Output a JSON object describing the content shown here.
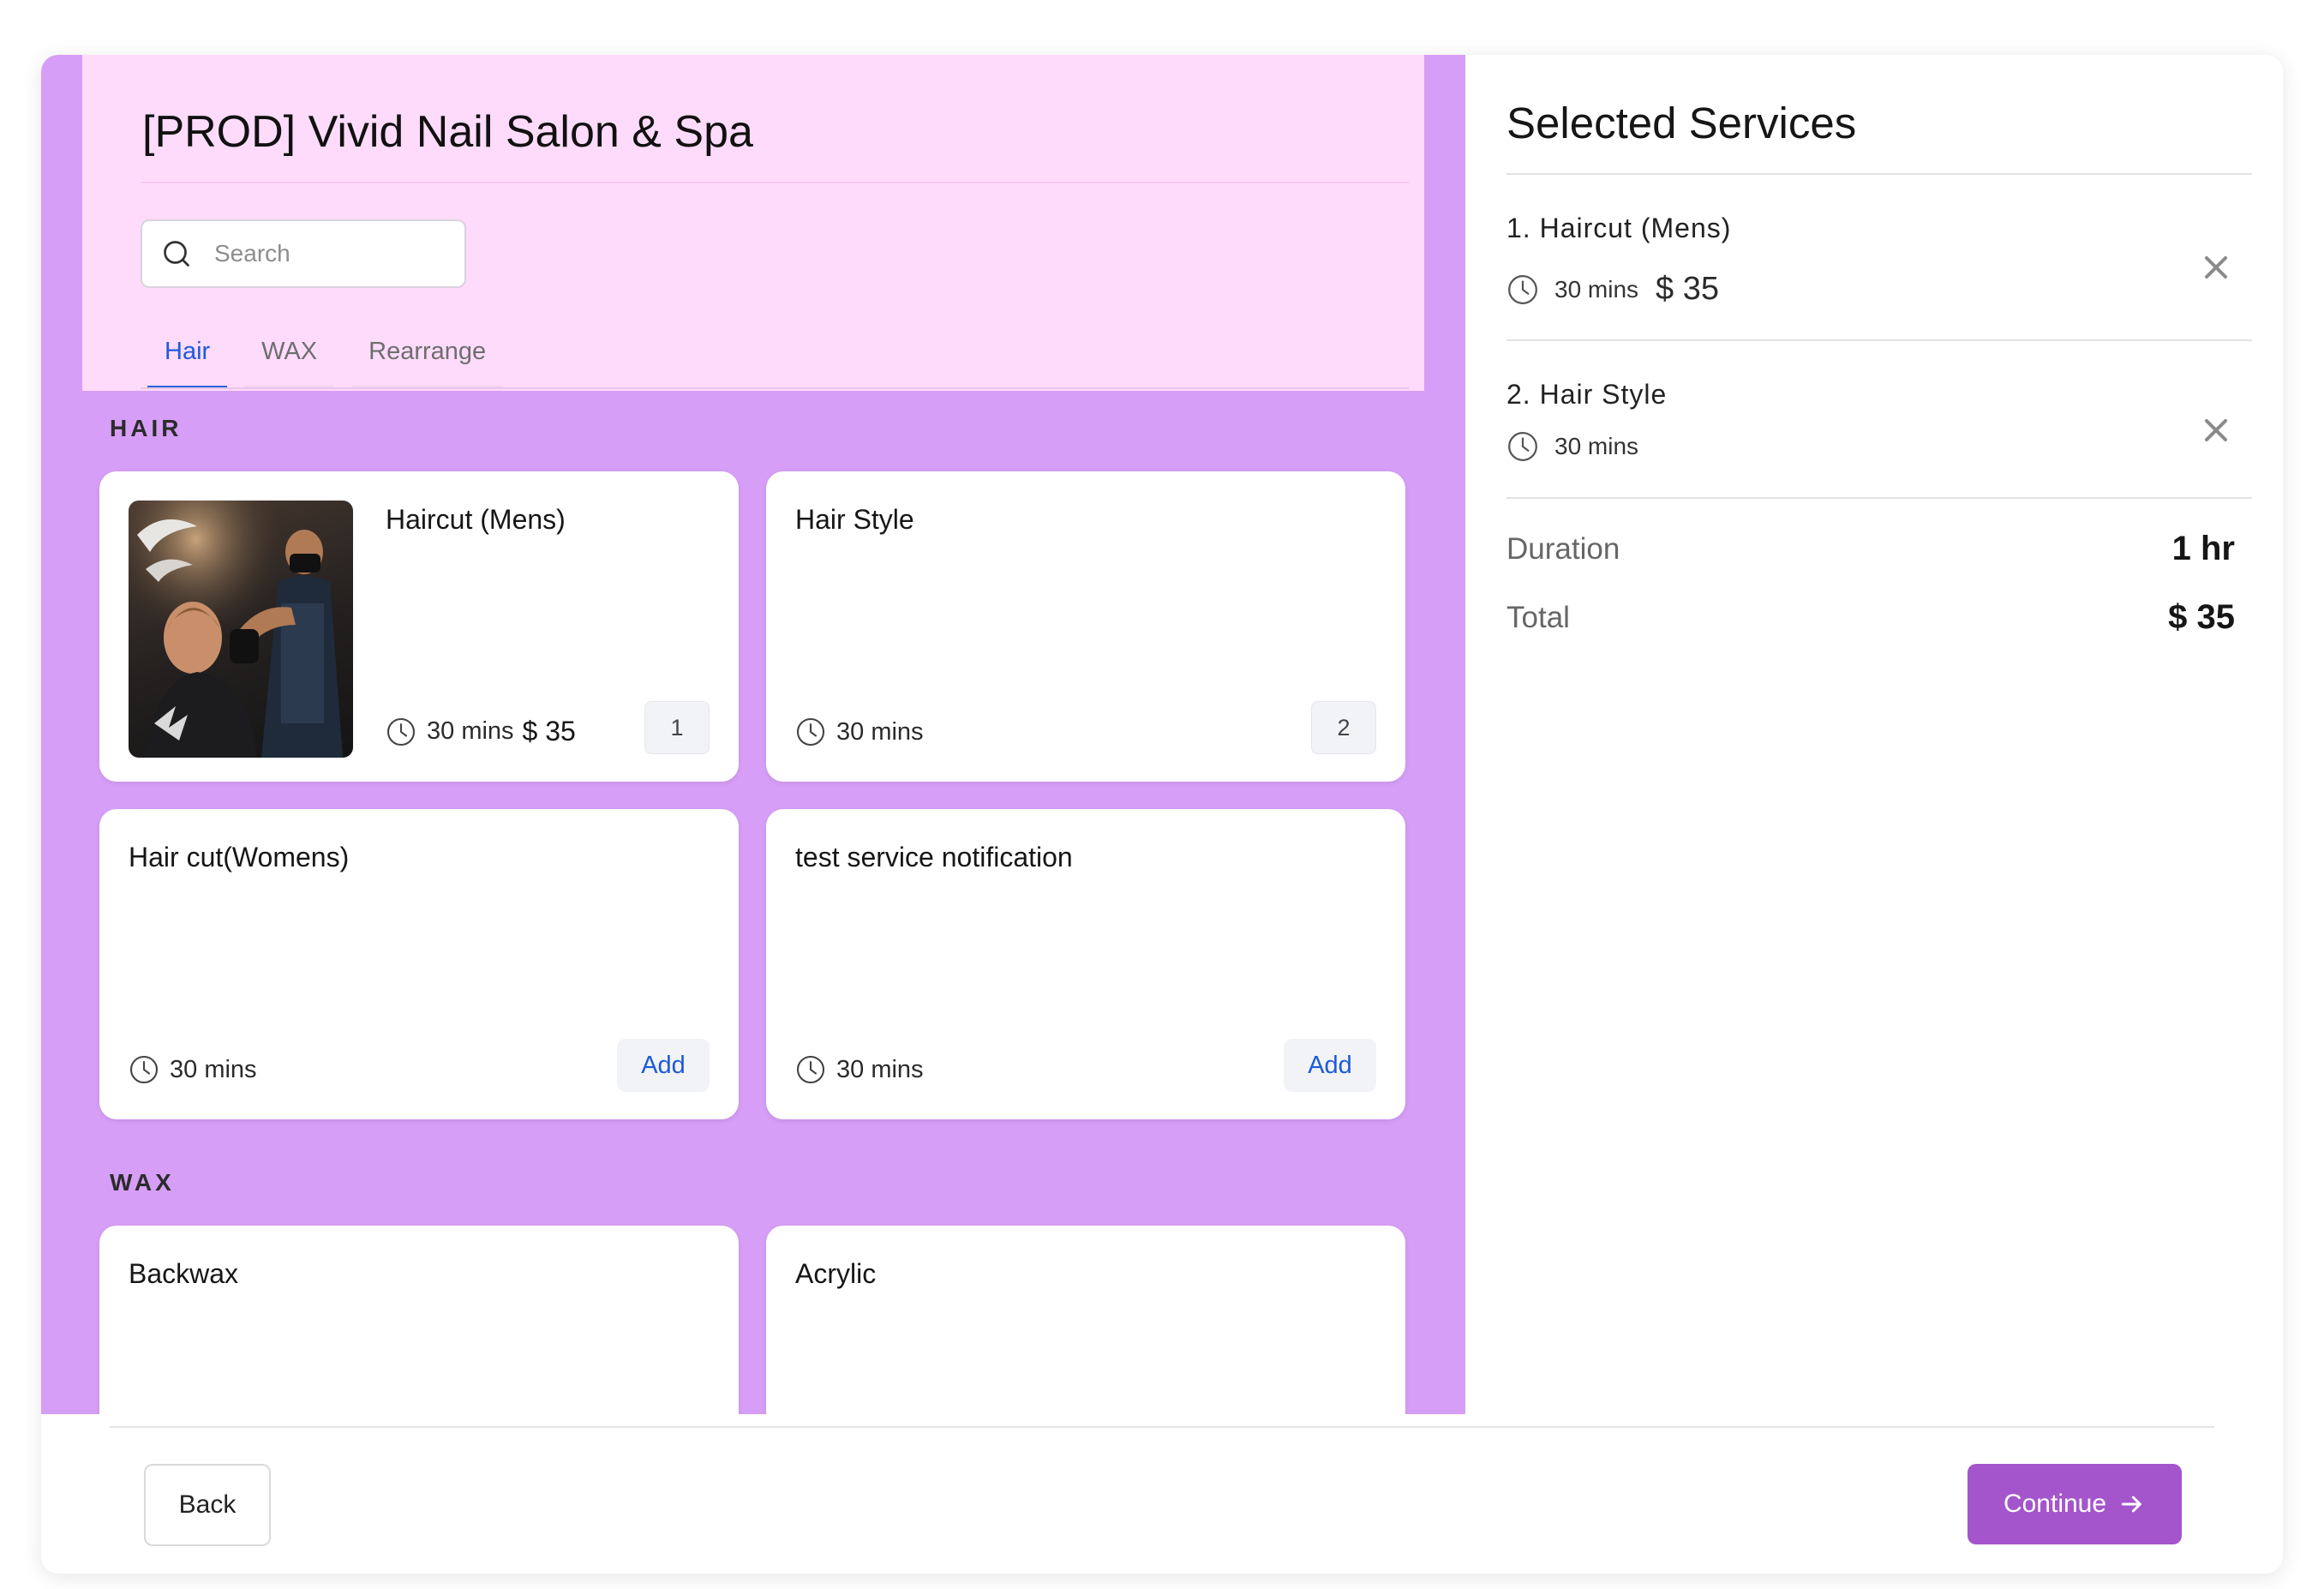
{
  "salon": {
    "title": "[PROD] Vivid Nail Salon & Spa"
  },
  "search": {
    "placeholder": "Search"
  },
  "tabs": [
    {
      "label": "Hair",
      "active": true
    },
    {
      "label": "WAX",
      "active": false
    },
    {
      "label": "Rearrange",
      "active": false
    }
  ],
  "sections": [
    {
      "label": "HAIR",
      "services": [
        {
          "name": "Haircut (Mens)",
          "duration": "30 mins",
          "price": "$ 35",
          "has_image": true,
          "selected_index": "1"
        },
        {
          "name": "Hair Style",
          "duration": "30 mins",
          "price": "",
          "has_image": false,
          "selected_index": "2"
        },
        {
          "name": "Hair cut(Womens)",
          "duration": "30 mins",
          "price": "",
          "has_image": false,
          "action": "Add"
        },
        {
          "name": "test service notification",
          "duration": "30 mins",
          "price": "",
          "has_image": false,
          "action": "Add"
        }
      ]
    },
    {
      "label": "WAX",
      "services": [
        {
          "name": "Backwax"
        },
        {
          "name": "Acrylic"
        }
      ]
    }
  ],
  "selected": {
    "title": "Selected Services",
    "items": [
      {
        "name": "1. Haircut (Mens)",
        "duration": "30 mins",
        "price": "$ 35"
      },
      {
        "name": "2. Hair Style",
        "duration": "30 mins",
        "price": ""
      }
    ],
    "summary": {
      "duration_label": "Duration",
      "duration_value": "1 hr",
      "total_label": "Total",
      "total_value": "$ 35"
    }
  },
  "footer": {
    "back_label": "Back",
    "continue_label": "Continue"
  },
  "icons": {
    "search": "search-icon",
    "clock": "clock-icon",
    "close": "close-icon",
    "arrow": "arrow-right-icon"
  },
  "colors": {
    "left_background": "#d69ef6",
    "header_background": "#fedbfb",
    "accent_blue": "#1d5ad8",
    "continue_button": "#a455cb"
  }
}
